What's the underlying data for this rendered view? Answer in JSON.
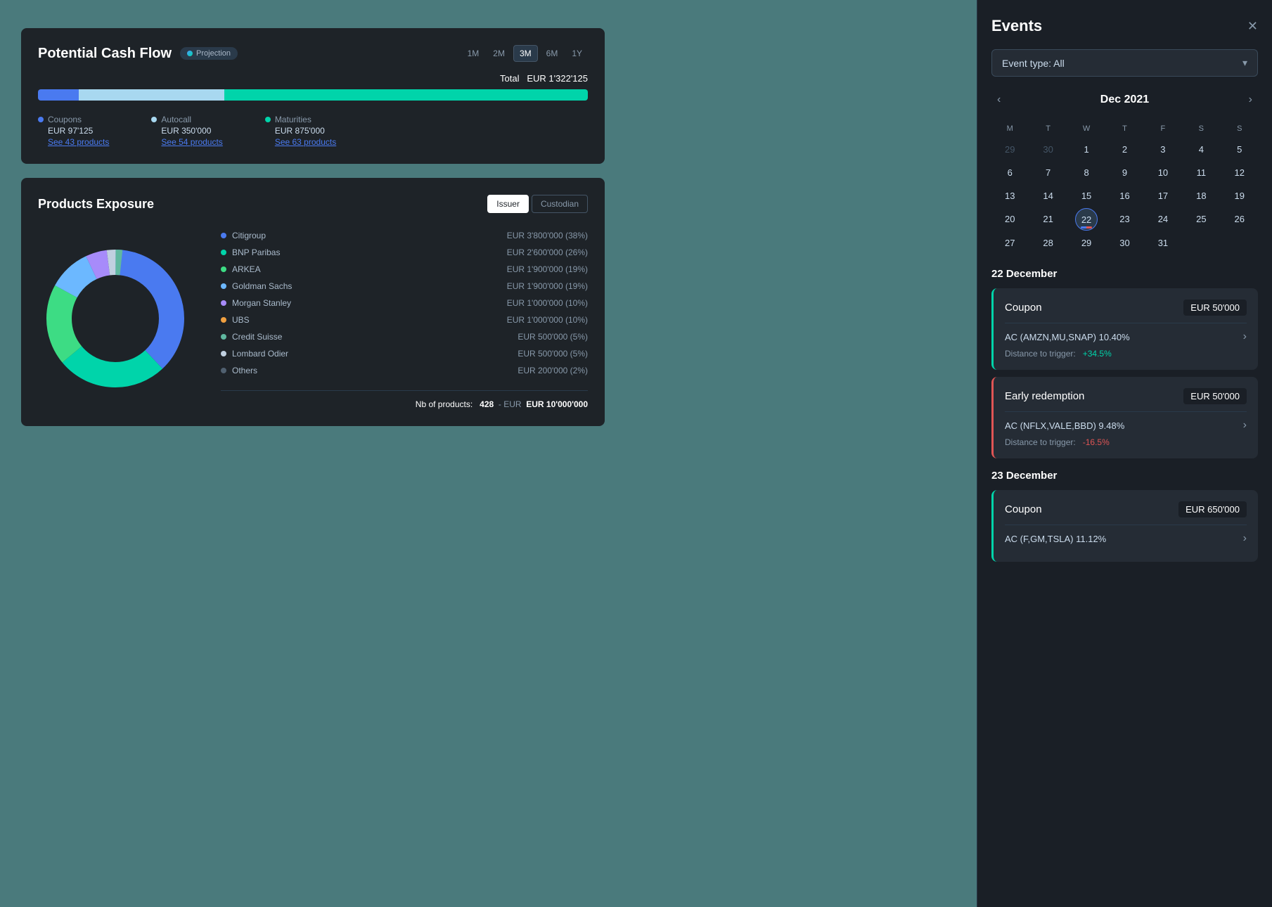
{
  "cashflow": {
    "title": "Potential Cash Flow",
    "projection_badge": "Projection",
    "total_label": "Total",
    "total_value": "EUR 1'322'125",
    "time_filters": [
      "1M",
      "2M",
      "3M",
      "6M",
      "1Y"
    ],
    "active_filter": "3M",
    "segments": [
      {
        "label": "Coupons",
        "amount": "EUR 97'125",
        "link": "See 43 products",
        "color": "#4a7af0",
        "pct": 7.4
      },
      {
        "label": "Autocall",
        "amount": "EUR 350'000",
        "link": "See 54 products",
        "color": "#a8d8f0",
        "pct": 26.5
      },
      {
        "label": "Maturities",
        "amount": "EUR 875'000",
        "link": "See 63 products",
        "color": "#00d4aa",
        "pct": 66.1
      }
    ]
  },
  "products_exposure": {
    "title": "Products Exposure",
    "buttons": [
      "Issuer",
      "Custodian"
    ],
    "active_button": "Issuer",
    "issuers": [
      {
        "name": "Citigroup",
        "value": "EUR 3'800'000 (38%)",
        "color": "#4a7af0"
      },
      {
        "name": "BNP Paribas",
        "value": "EUR 2'600'000 (26%)",
        "color": "#00d4aa"
      },
      {
        "name": "ARKEA",
        "value": "EUR 1'900'000 (19%)",
        "color": "#3ddc84"
      },
      {
        "name": "Goldman Sachs",
        "value": "EUR 1'900'000 (19%)",
        "color": "#6cb8ff"
      },
      {
        "name": "Morgan Stanley",
        "value": "EUR 1'000'000 (10%)",
        "color": "#a78bfa"
      },
      {
        "name": "UBS",
        "value": "EUR 1'000'000 (10%)",
        "color": "#f0a040"
      },
      {
        "name": "Credit Suisse",
        "value": "EUR 500'000 (5%)",
        "color": "#60b8a0"
      },
      {
        "name": "Lombard Odier",
        "value": "EUR 500'000 (5%)",
        "color": "#c0d0e0"
      },
      {
        "name": "Others",
        "value": "EUR 200'000 (2%)",
        "color": "#506070"
      }
    ],
    "footer_label": "Nb of products:",
    "footer_count": "428",
    "footer_value": "EUR 10'000'000"
  },
  "events_panel": {
    "title": "Events",
    "close_label": "✕",
    "event_type_label": "Event type: All",
    "calendar": {
      "month_year": "Dec 2021",
      "day_headers": [
        "M",
        "T",
        "W",
        "T",
        "F",
        "S",
        "S"
      ],
      "weeks": [
        [
          {
            "day": "29",
            "other": true
          },
          {
            "day": "30",
            "other": true
          },
          {
            "day": "1"
          },
          {
            "day": "2"
          },
          {
            "day": "3"
          },
          {
            "day": "4"
          },
          {
            "day": "5"
          }
        ],
        [
          {
            "day": "6"
          },
          {
            "day": "7"
          },
          {
            "day": "8"
          },
          {
            "day": "9"
          },
          {
            "day": "10"
          },
          {
            "day": "11"
          },
          {
            "day": "12"
          }
        ],
        [
          {
            "day": "13"
          },
          {
            "day": "14"
          },
          {
            "day": "15"
          },
          {
            "day": "16"
          },
          {
            "day": "17"
          },
          {
            "day": "18"
          },
          {
            "day": "19"
          }
        ],
        [
          {
            "day": "20"
          },
          {
            "day": "21"
          },
          {
            "day": "22",
            "today": true,
            "has_events": true
          },
          {
            "day": "23"
          },
          {
            "day": "24"
          },
          {
            "day": "25"
          },
          {
            "day": "26"
          }
        ],
        [
          {
            "day": "27"
          },
          {
            "day": "28"
          },
          {
            "day": "29"
          },
          {
            "day": "30"
          },
          {
            "day": "31"
          },
          {
            "day": "",
            "other": true
          },
          {
            "day": "",
            "other": true
          }
        ]
      ]
    },
    "sections": [
      {
        "date_label": "22 December",
        "events": [
          {
            "type": "Coupon",
            "type_class": "coupon",
            "amount": "EUR 50'000",
            "description": "AC (AMZN,MU,SNAP) 10.40%",
            "trigger_label": "Distance to trigger:",
            "trigger_value": "+34.5%",
            "trigger_class": "positive"
          },
          {
            "type": "Early redemption",
            "type_class": "redemption",
            "amount": "EUR 50'000",
            "description": "AC (NFLX,VALE,BBD) 9.48%",
            "trigger_label": "Distance to trigger:",
            "trigger_value": "-16.5%",
            "trigger_class": "negative"
          }
        ]
      },
      {
        "date_label": "23 December",
        "events": [
          {
            "type": "Coupon",
            "type_class": "coupon",
            "amount": "EUR 650'000",
            "description": "AC (F,GM,TSLA) 11.12%",
            "trigger_label": "",
            "trigger_value": "",
            "trigger_class": ""
          }
        ]
      }
    ]
  }
}
